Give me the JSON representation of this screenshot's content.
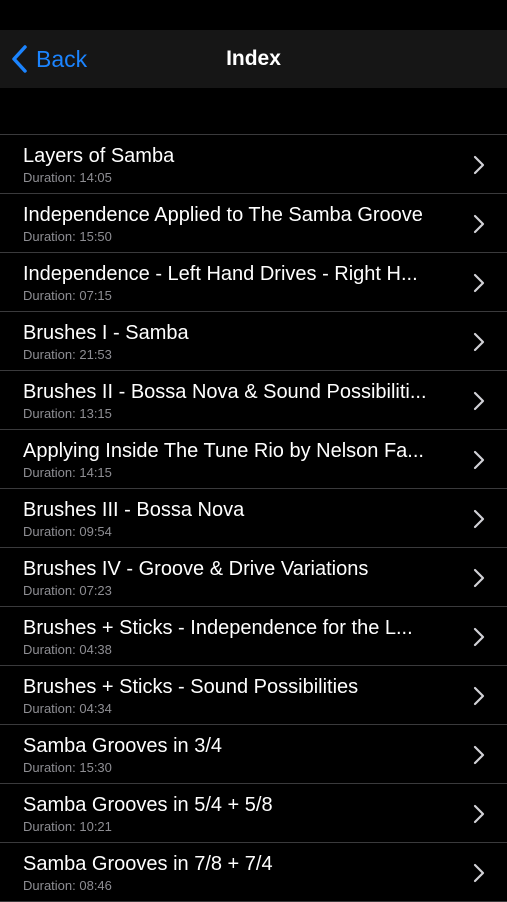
{
  "nav": {
    "back_label": "Back",
    "title": "Index"
  },
  "colors": {
    "accent": "#1b84ff",
    "background": "#000000",
    "nav_background": "#161616",
    "secondary_text": "#8e8e93",
    "separator": "#3a3a3c"
  },
  "icons": {
    "back": "chevron-left-icon",
    "row": "chevron-right-icon"
  },
  "lessons": [
    {
      "title": "Layers of Samba",
      "duration": "Duration: 14:05"
    },
    {
      "title": "Independence Applied to The Samba Groove",
      "duration": "Duration: 15:50"
    },
    {
      "title": "Independence - Left Hand Drives - Right H...",
      "duration": "Duration: 07:15"
    },
    {
      "title": "Brushes I - Samba",
      "duration": "Duration: 21:53"
    },
    {
      "title": "Brushes II - Bossa Nova & Sound Possibiliti...",
      "duration": "Duration: 13:15"
    },
    {
      "title": "Applying Inside The Tune Rio by Nelson Fa...",
      "duration": "Duration: 14:15"
    },
    {
      "title": "Brushes III - Bossa Nova",
      "duration": "Duration: 09:54"
    },
    {
      "title": "Brushes IV - Groove & Drive Variations",
      "duration": "Duration: 07:23"
    },
    {
      "title": "Brushes + Sticks - Independence for the L...",
      "duration": "Duration: 04:38"
    },
    {
      "title": "Brushes + Sticks - Sound Possibilities",
      "duration": "Duration: 04:34"
    },
    {
      "title": "Samba Grooves in 3/4",
      "duration": "Duration: 15:30"
    },
    {
      "title": "Samba Grooves in 5/4 + 5/8",
      "duration": "Duration: 10:21"
    },
    {
      "title": "Samba Grooves in 7/8 + 7/4",
      "duration": "Duration: 08:46"
    }
  ]
}
